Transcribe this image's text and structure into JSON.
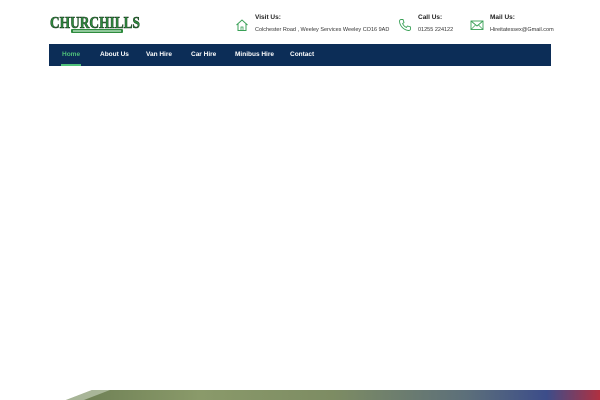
{
  "brand": {
    "logo_text": "CHURCHILLS",
    "logo_tagline": "",
    "colors": {
      "green": "#2e8b3e",
      "navy": "#0c2d57",
      "accent": "#4fc07a"
    }
  },
  "contacts": [
    {
      "icon": "house-icon",
      "title": "Visit Us:",
      "value": "Colchester Road , Weeley Services Weeley CO16 9AD"
    },
    {
      "icon": "phone-icon",
      "title": "Call Us:",
      "value": "01255 224122"
    },
    {
      "icon": "envelope-icon",
      "title": "Mail Us:",
      "value": "Hireitatessex@Gmail.com"
    }
  ],
  "nav": {
    "items": [
      {
        "label": "Home",
        "active": true
      },
      {
        "label": "About Us"
      },
      {
        "label": "Van Hire"
      },
      {
        "label": "Car Hire"
      },
      {
        "label": "Minibus Hire"
      },
      {
        "label": "Contact"
      }
    ]
  }
}
